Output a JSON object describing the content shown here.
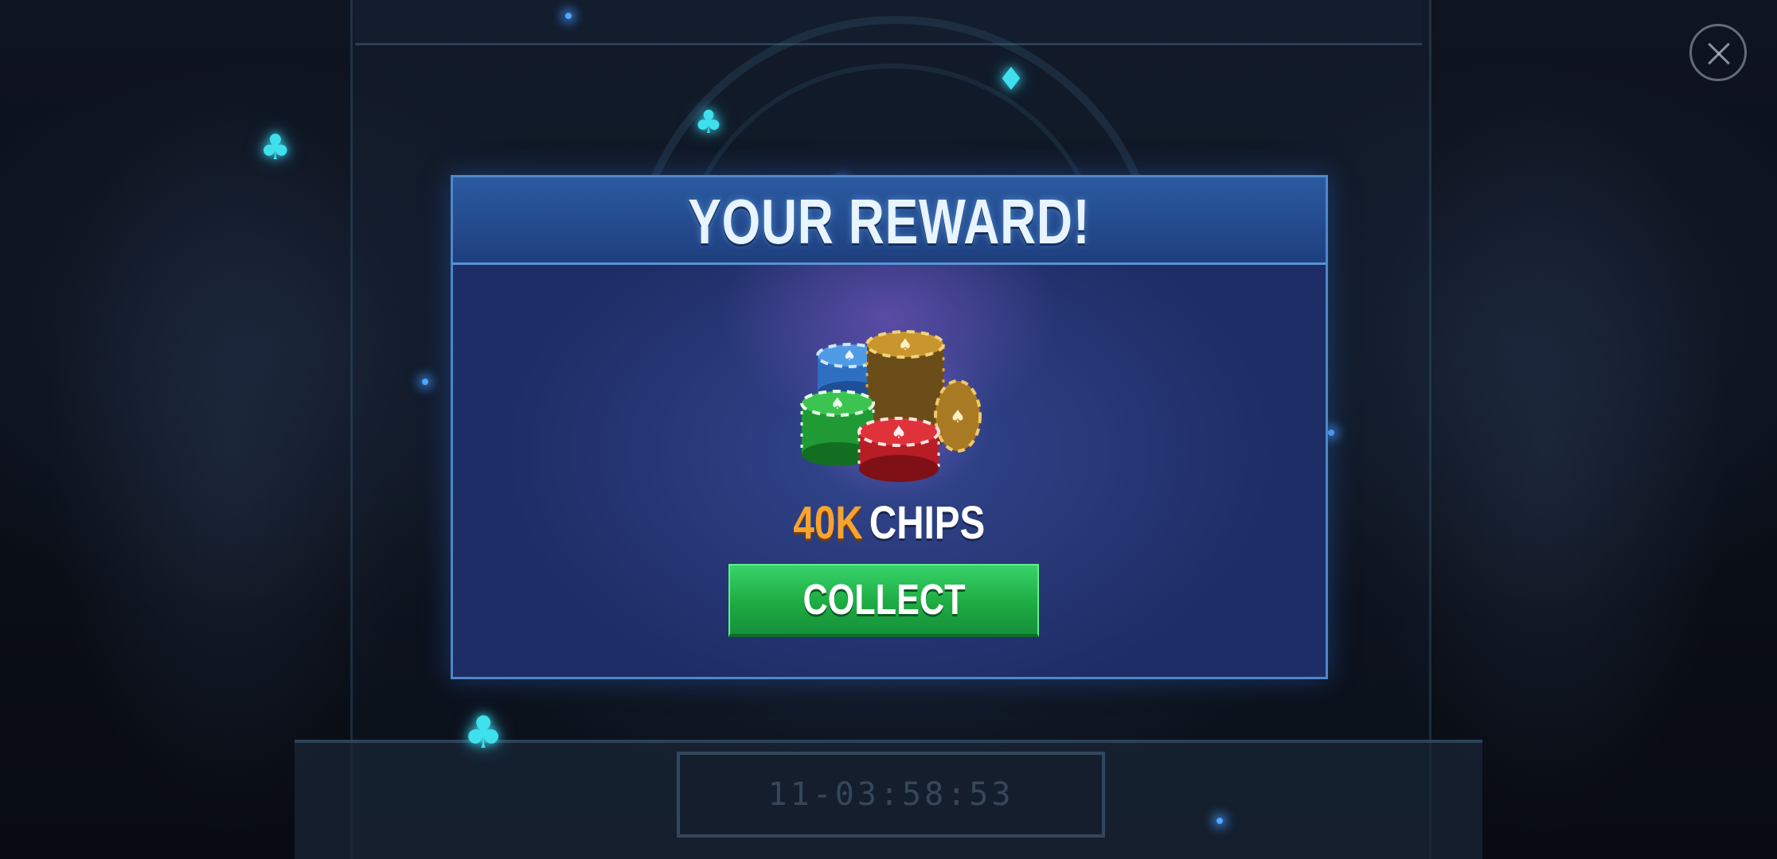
{
  "modal": {
    "title": "YOUR REWARD!",
    "reward_amount": "40K",
    "reward_unit": "CHIPS",
    "collect_label": "COLLECT"
  },
  "background": {
    "plate_text": "11-03:58:53"
  },
  "icons": {
    "close": "close-icon",
    "chips": "chip-pile-icon",
    "suits": [
      "club-icon",
      "spade-icon",
      "heart-icon",
      "diamond-icon"
    ]
  },
  "colors": {
    "amount": "#f6a431",
    "button": "#1eab43",
    "modal_border": "#4f86c9",
    "suit_glow": "#3fe0ee"
  }
}
